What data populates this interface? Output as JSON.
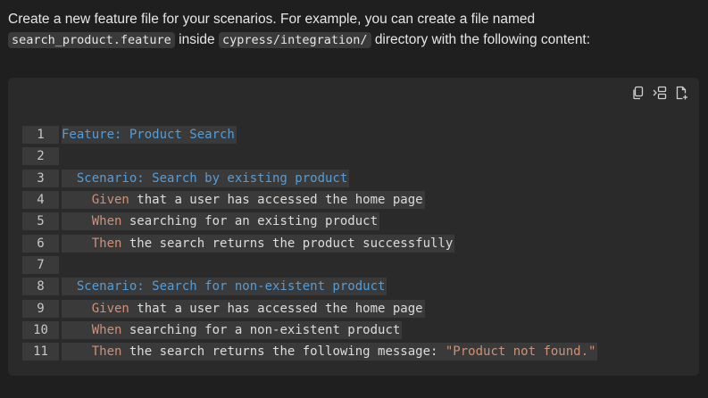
{
  "intro": {
    "text_before": "Create a new feature file for your scenarios. For example, you can create a file named",
    "filename": "search_product.feature",
    "text_middle": "inside",
    "directory": "cypress/integration/",
    "text_after": "directory with the following content:"
  },
  "toolbar": {
    "copy_icon": "copy-icon",
    "insert_icon": "insert-icon",
    "new_file_icon": "new-file-icon"
  },
  "code": {
    "lines": [
      {
        "num": "1",
        "indent": "",
        "kw": "Feature: Product Search",
        "rest": ""
      },
      {
        "num": "2",
        "indent": "",
        "kw": "",
        "rest": ""
      },
      {
        "num": "3",
        "indent": "  ",
        "kw": "Scenario: Search by existing product",
        "rest": ""
      },
      {
        "num": "4",
        "indent": "    ",
        "step": "Given",
        "rest": " that a user has accessed the home page"
      },
      {
        "num": "5",
        "indent": "    ",
        "step": "When",
        "rest": " searching for an existing product"
      },
      {
        "num": "6",
        "indent": "    ",
        "step": "Then",
        "rest": " the search returns the product successfully"
      },
      {
        "num": "7",
        "indent": "",
        "kw": "",
        "rest": ""
      },
      {
        "num": "8",
        "indent": "  ",
        "kw": "Scenario: Search for non-existent product",
        "rest": ""
      },
      {
        "num": "9",
        "indent": "    ",
        "step": "Given",
        "rest": " that a user has accessed the home page"
      },
      {
        "num": "10",
        "indent": "    ",
        "step": "When",
        "rest": " searching for a non-existent product"
      },
      {
        "num": "11",
        "indent": "    ",
        "step": "Then",
        "rest": " the search returns the following message: ",
        "str": "\"Product not found.\""
      }
    ]
  }
}
